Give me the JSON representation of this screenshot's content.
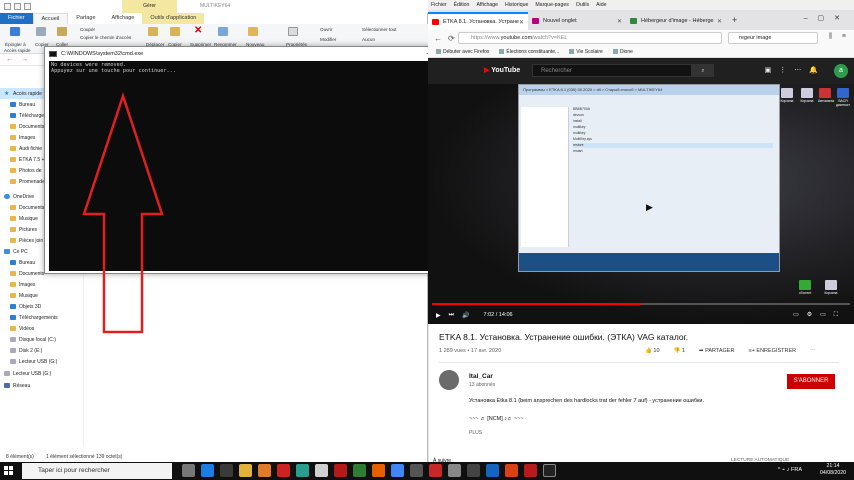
{
  "explorer": {
    "ribbon_tabs": [
      "Fichier",
      "Accueil",
      "Partage",
      "Affichage",
      "Outils d'application"
    ],
    "manage_tab": "Gérer",
    "window_title": "MULTIKEY64",
    "ribbon": {
      "pin_label": "Épingler à",
      "pin_label2": "Accès rapide",
      "copy_label": "Copier",
      "paste_label": "Coller",
      "cut_label": "Couper",
      "copy_path_label": "Copier le chemin d'accès",
      "move_label": "Déplacer",
      "copy_to_label": "Copier",
      "delete_label": "Supprimer",
      "rename_label": "Renommer",
      "new_label": "Nouveau",
      "properties_label": "Propriétés",
      "open_label": "Ouvrir",
      "edit_label": "Modifier",
      "select_all_label": "Sélectionner tout",
      "select_none_label": "Aucun"
    },
    "nav": [
      {
        "label": "Accès rapide",
        "icon": "star-icon",
        "selected": true
      },
      {
        "label": "Bureau",
        "icon": "desktop-icon"
      },
      {
        "label": "Téléchargements",
        "icon": "download-icon"
      },
      {
        "label": "Documents",
        "icon": "folder-icon"
      },
      {
        "label": "Images",
        "icon": "folder-icon"
      },
      {
        "label": "Audi fichie",
        "icon": "folder-icon"
      },
      {
        "label": "ETKA 7.5 +",
        "icon": "folder-icon"
      },
      {
        "label": "Photos de",
        "icon": "folder-icon"
      },
      {
        "label": "Promenade",
        "icon": "folder-icon"
      },
      {
        "label": "OneDrive",
        "icon": "cloud-icon"
      },
      {
        "label": "Documents",
        "icon": "folder-icon"
      },
      {
        "label": "Musique",
        "icon": "folder-icon"
      },
      {
        "label": "Pictures",
        "icon": "folder-icon"
      },
      {
        "label": "Pièces join",
        "icon": "folder-icon"
      },
      {
        "label": "Ce PC",
        "icon": "pc-icon"
      },
      {
        "label": "Bureau",
        "icon": "desktop-icon"
      },
      {
        "label": "Documents",
        "icon": "folder-icon"
      },
      {
        "label": "Images",
        "icon": "folder-icon"
      },
      {
        "label": "Musique",
        "icon": "folder-icon"
      },
      {
        "label": "Objets 3D",
        "icon": "cube-icon"
      },
      {
        "label": "Téléchargements",
        "icon": "download-icon"
      },
      {
        "label": "Vidéos",
        "icon": "folder-icon"
      },
      {
        "label": "Disque local (C:)",
        "icon": "drive-icon"
      },
      {
        "label": "Disk 2 (E:)",
        "icon": "drive-icon"
      },
      {
        "label": "Lecteur USB (G:)",
        "icon": "drive-icon"
      },
      {
        "label": "Lecteur USB (G:)",
        "icon": "drive-icon"
      },
      {
        "label": "Réseau",
        "icon": "network-icon"
      }
    ],
    "status": {
      "count": "8 élément(s)",
      "selected": "1 élément sélectionné 139 octet(s)"
    }
  },
  "cmd": {
    "title": "C:\\WINDOWS\\system32\\cmd.exe",
    "lines": [
      "No devices were removed.",
      "Appuyez sur une touche pour continuer..."
    ]
  },
  "firefox": {
    "menu": [
      "Fichier",
      "Édition",
      "Affichage",
      "Historique",
      "Marque-pages",
      "Outils",
      "Aide"
    ],
    "tabs": [
      {
        "label": "ETKA 8.1. Установка. Устране",
        "active": true,
        "favicon": "#ff0000"
      },
      {
        "label": "Nouvel onglet",
        "active": false,
        "favicon": "#b5007f"
      },
      {
        "label": "Hébergeur d'image - Héberge",
        "active": false,
        "favicon": "#2b8a3e"
      }
    ],
    "url_prefix": "https://www.",
    "url_domain": "youtube.com",
    "url_rest": "/watch?v=KEL",
    "search_value": "regeur image",
    "bookmarks": [
      "Débuter avec Firefox",
      "Élections constituante...",
      "Vie Scolaire",
      "Dione"
    ]
  },
  "youtube": {
    "logo": "YouTube",
    "search_placeholder": "Rechercher",
    "avatar_letter": "a",
    "time": "7:02 / 14:06",
    "progress": 0.5,
    "title": "ETKA 8.1. Установка. Устранение ошибки. (ЭТКА) VAG каталог.",
    "views": "1 289 vues • 17 avr. 2020",
    "likes": "10",
    "dislikes": "1",
    "share": "PARTAGER",
    "save": "ENREGISTRER",
    "channel": "Ital_Car",
    "subscribers": "13 abonnés",
    "subscribe": "S'ABONNER",
    "description": "Установка Etka 8.1 (beim ansprechen des hardlocks trat der fehler 7 auf) - устранение ошибки.",
    "music": "~~~ ♬ [NCM] ♪♬ ~~~",
    "more": "PLUS",
    "autoplay": "LECTURE AUTOMATIQUE",
    "below_label": "À suivre",
    "video_overlay": {
      "breadcrumb": "Программы > ETKA 8.1 (030) 00.2020 > dll > Старый способ > MULTIKEY64",
      "rows": [
        "ВВВВ700А",
        "devcon",
        "install",
        "multikey",
        "multikey",
        "MultiKey.sys",
        "restore",
        "restart"
      ],
      "desktop_icons": [
        "Корзина",
        "Корзина",
        "Автомагаз",
        "ВАСЯ диагност"
      ],
      "desktop_icons_lower": [
        "uTorrent",
        "Корзина"
      ]
    }
  },
  "taskbar": {
    "search_placeholder": "Taper ici pour rechercher",
    "time": "21:14",
    "date": "04/08/2020",
    "lang": "FRA"
  }
}
